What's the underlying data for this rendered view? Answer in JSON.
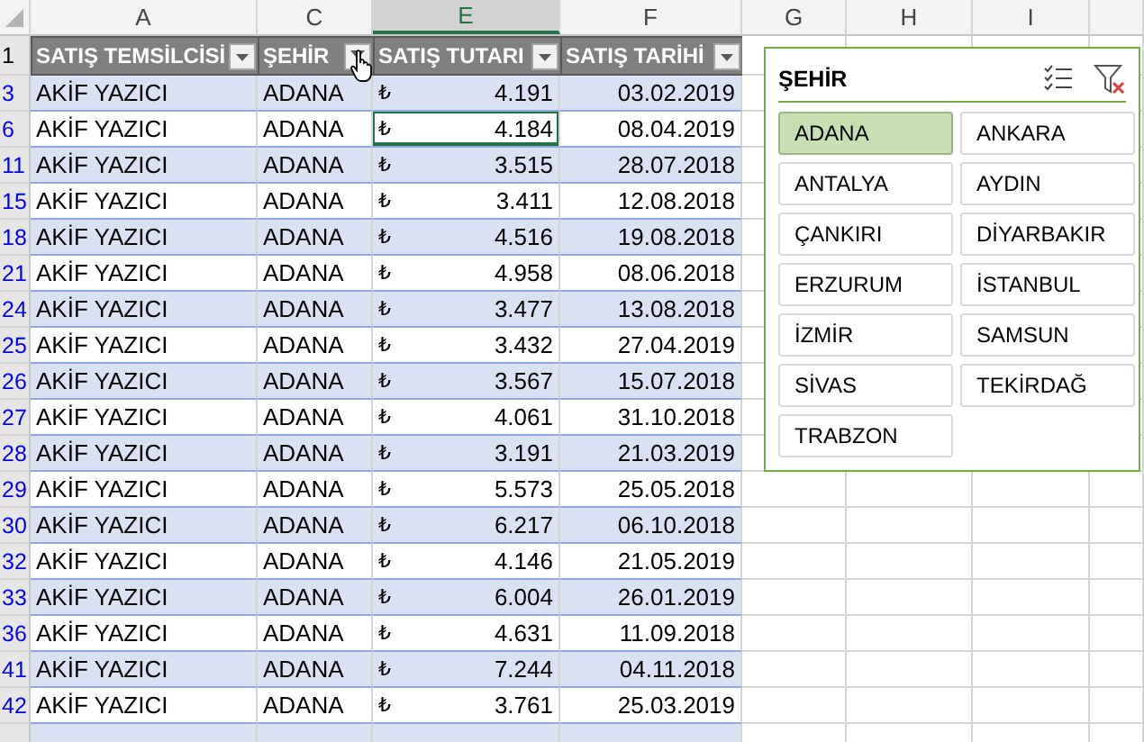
{
  "columns": [
    {
      "letter": "A",
      "selected": false
    },
    {
      "letter": "C",
      "selected": false
    },
    {
      "letter": "E",
      "selected": true
    },
    {
      "letter": "F",
      "selected": false
    },
    {
      "letter": "G",
      "selected": false
    },
    {
      "letter": "H",
      "selected": false
    },
    {
      "letter": "I",
      "selected": false
    }
  ],
  "table": {
    "header_row": "1",
    "headers": [
      {
        "label": "SATIŞ TEMSİLCİSİ",
        "filtered": false
      },
      {
        "label": "ŞEHİR",
        "filtered": true
      },
      {
        "label": "SATIŞ TUTARI",
        "filtered": false
      },
      {
        "label": "SATIŞ TARİHİ",
        "filtered": false
      }
    ],
    "rows": [
      {
        "row": "3",
        "rep": "AKİF YAZICI",
        "city": "ADANA",
        "currency": "₺",
        "amount": "4.191",
        "date": "03.02.2019",
        "selected": false
      },
      {
        "row": "6",
        "rep": "AKİF YAZICI",
        "city": "ADANA",
        "currency": "₺",
        "amount": "4.184",
        "date": "08.04.2019",
        "selected": true
      },
      {
        "row": "11",
        "rep": "AKİF YAZICI",
        "city": "ADANA",
        "currency": "₺",
        "amount": "3.515",
        "date": "28.07.2018",
        "selected": false
      },
      {
        "row": "15",
        "rep": "AKİF YAZICI",
        "city": "ADANA",
        "currency": "₺",
        "amount": "3.411",
        "date": "12.08.2018",
        "selected": false
      },
      {
        "row": "18",
        "rep": "AKİF YAZICI",
        "city": "ADANA",
        "currency": "₺",
        "amount": "4.516",
        "date": "19.08.2018",
        "selected": false
      },
      {
        "row": "21",
        "rep": "AKİF YAZICI",
        "city": "ADANA",
        "currency": "₺",
        "amount": "4.958",
        "date": "08.06.2018",
        "selected": false
      },
      {
        "row": "24",
        "rep": "AKİF YAZICI",
        "city": "ADANA",
        "currency": "₺",
        "amount": "3.477",
        "date": "13.08.2018",
        "selected": false
      },
      {
        "row": "25",
        "rep": "AKİF YAZICI",
        "city": "ADANA",
        "currency": "₺",
        "amount": "3.432",
        "date": "27.04.2019",
        "selected": false
      },
      {
        "row": "26",
        "rep": "AKİF YAZICI",
        "city": "ADANA",
        "currency": "₺",
        "amount": "3.567",
        "date": "15.07.2018",
        "selected": false
      },
      {
        "row": "27",
        "rep": "AKİF YAZICI",
        "city": "ADANA",
        "currency": "₺",
        "amount": "4.061",
        "date": "31.10.2018",
        "selected": false
      },
      {
        "row": "28",
        "rep": "AKİF YAZICI",
        "city": "ADANA",
        "currency": "₺",
        "amount": "3.191",
        "date": "21.03.2019",
        "selected": false
      },
      {
        "row": "29",
        "rep": "AKİF YAZICI",
        "city": "ADANA",
        "currency": "₺",
        "amount": "5.573",
        "date": "25.05.2018",
        "selected": false
      },
      {
        "row": "30",
        "rep": "AKİF YAZICI",
        "city": "ADANA",
        "currency": "₺",
        "amount": "6.217",
        "date": "06.10.2018",
        "selected": false
      },
      {
        "row": "32",
        "rep": "AKİF YAZICI",
        "city": "ADANA",
        "currency": "₺",
        "amount": "4.146",
        "date": "21.05.2019",
        "selected": false
      },
      {
        "row": "33",
        "rep": "AKİF YAZICI",
        "city": "ADANA",
        "currency": "₺",
        "amount": "6.004",
        "date": "26.01.2019",
        "selected": false
      },
      {
        "row": "36",
        "rep": "AKİF YAZICI",
        "city": "ADANA",
        "currency": "₺",
        "amount": "4.631",
        "date": "11.09.2018",
        "selected": false
      },
      {
        "row": "41",
        "rep": "AKİF YAZICI",
        "city": "ADANA",
        "currency": "₺",
        "amount": "7.244",
        "date": "04.11.2018",
        "selected": false
      },
      {
        "row": "42",
        "rep": "AKİF YAZICI",
        "city": "ADANA",
        "currency": "₺",
        "amount": "3.761",
        "date": "25.03.2019",
        "selected": false
      }
    ]
  },
  "slicer": {
    "title": "ŞEHİR",
    "items": [
      {
        "label": "ADANA",
        "selected": true
      },
      {
        "label": "ANKARA",
        "selected": false
      },
      {
        "label": "ANTALYA",
        "selected": false
      },
      {
        "label": "AYDIN",
        "selected": false
      },
      {
        "label": "ÇANKIRI",
        "selected": false
      },
      {
        "label": "DİYARBAKIR",
        "selected": false
      },
      {
        "label": "ERZURUM",
        "selected": false
      },
      {
        "label": "İSTANBUL",
        "selected": false
      },
      {
        "label": "İZMİR",
        "selected": false
      },
      {
        "label": "SAMSUN",
        "selected": false
      },
      {
        "label": "SİVAS",
        "selected": false
      },
      {
        "label": "TEKİRDAĞ",
        "selected": false
      },
      {
        "label": "TRABZON",
        "selected": false
      }
    ]
  }
}
